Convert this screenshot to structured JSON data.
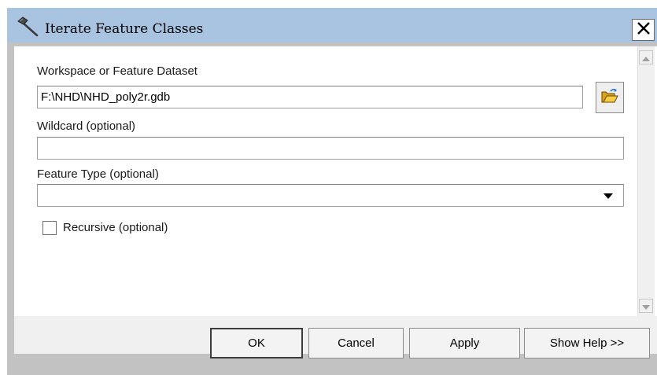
{
  "window": {
    "title": "Iterate Feature Classes",
    "close_glyph": "✕",
    "icon": "hammer-tool-icon"
  },
  "form": {
    "workspace": {
      "label": "Workspace or Feature Dataset",
      "value": "F:\\NHD\\NHD_poly2r.gdb",
      "browse_icon": "folder-open-icon"
    },
    "wildcard": {
      "label": "Wildcard (optional)",
      "value": ""
    },
    "feature_type": {
      "label": "Feature Type (optional)",
      "value": ""
    },
    "recursive": {
      "label": "Recursive (optional)",
      "checked": false
    }
  },
  "buttons": {
    "ok": "OK",
    "cancel": "Cancel",
    "apply": "Apply",
    "show_help": "Show Help >>"
  },
  "colors": {
    "titlebar": "#a9c4e0",
    "frame": "#c2c2c2",
    "footer": "#f0f0f0"
  }
}
